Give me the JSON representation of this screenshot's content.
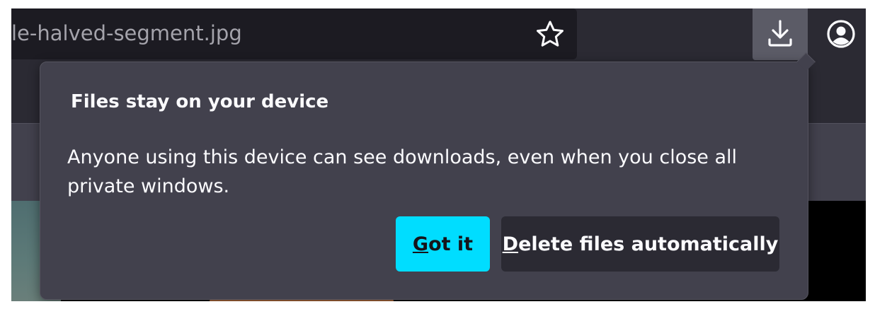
{
  "toolbar": {
    "url_text": "le-halved-segment.jpg",
    "bookmark_icon": "star-outline-icon",
    "downloads_icon": "download-arrow-icon",
    "account_icon": "account-circle-icon"
  },
  "panel": {
    "title": "Files stay on your device",
    "body": "Anyone using this device can see downloads, even when you close all private windows.",
    "primary_button": {
      "access_key": "G",
      "label_rest": "ot it"
    },
    "secondary_button": {
      "access_key": "D",
      "label_rest": "elete files automatically"
    }
  },
  "colors": {
    "primary_accent": "#00ddff",
    "panel_bg": "#42414d",
    "toolbar_bg": "#2b2a33",
    "urlbar_bg": "#1c1b22",
    "active_button_bg": "#5b5b66"
  }
}
